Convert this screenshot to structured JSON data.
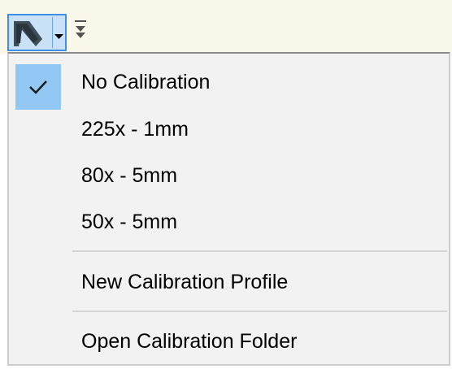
{
  "toolbar": {
    "calibration_button_icon": "calibration-tool-icon",
    "dropdown_icon": "dropdown-arrow-icon",
    "overflow_icon": "overflow-chevron-icon"
  },
  "menu": {
    "items": [
      {
        "label": "No Calibration",
        "checked": true
      },
      {
        "label": "225x - 1mm",
        "checked": false
      },
      {
        "label": "80x - 5mm",
        "checked": false
      },
      {
        "label": "50x - 5mm",
        "checked": false
      }
    ],
    "actions": [
      {
        "label": "New Calibration Profile"
      },
      {
        "label": "Open Calibration Folder"
      }
    ]
  },
  "colors": {
    "toolbar_bg": "#f9f8eb",
    "menu_bg": "#f2f2f2",
    "selected_button_bg": "#c9e0f7",
    "selected_button_border": "#3d8ee6",
    "check_highlight": "#93c8f5",
    "separator": "#d4d4d4"
  }
}
